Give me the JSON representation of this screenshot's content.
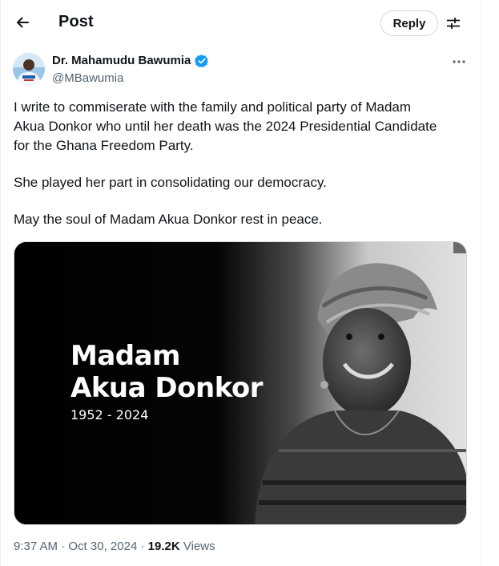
{
  "header": {
    "title": "Post",
    "reply_label": "Reply"
  },
  "icons": {
    "back": "arrow-left-icon",
    "filter": "sliders-icon",
    "verified": "verified-badge-icon",
    "more": "more-horizontal-icon"
  },
  "colors": {
    "verified": "#1d9bf0",
    "text_primary": "#0f1419",
    "text_secondary": "#536471",
    "border": "#cfd9de"
  },
  "author": {
    "name": "Dr. Mahamudu Bawumia",
    "handle": "@MBawumia"
  },
  "tweet": {
    "paragraph1_line1": "I write to commiserate with the family  and political party of Madam",
    "paragraph1_line2": "Akua Donkor who until her death was the 2024 Presidential Candidate",
    "paragraph1_line3": "for the Ghana Freedom Party.",
    "paragraph2": "She played her part in consolidating our democracy.",
    "paragraph3": "May the soul of Madam Akua Donkor rest in peace."
  },
  "media": {
    "name_line1": "Madam",
    "name_line2": "Akua Donkor",
    "years": "1952 - 2024"
  },
  "meta": {
    "time": "9:37 AM",
    "sep1": " · ",
    "date": "Oct 30, 2024",
    "sep2": " · ",
    "views_count": "19.2K",
    "views_label": " Views"
  }
}
